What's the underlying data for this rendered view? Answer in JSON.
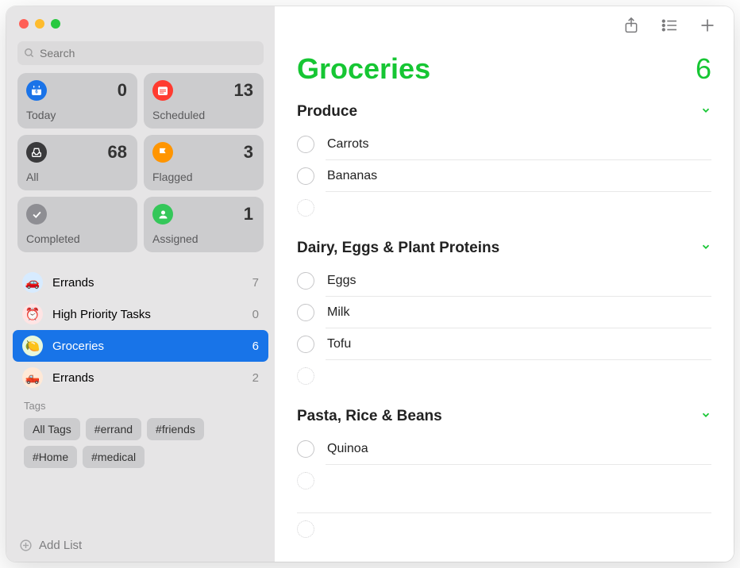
{
  "search": {
    "placeholder": "Search"
  },
  "smart": [
    {
      "label": "Today",
      "count": 0,
      "color": "#1a73e8",
      "icon": "calendar"
    },
    {
      "label": "Scheduled",
      "count": 13,
      "color": "#ff3b30",
      "icon": "calendar-lines"
    },
    {
      "label": "All",
      "count": 68,
      "color": "#3a3a3c",
      "icon": "tray"
    },
    {
      "label": "Flagged",
      "count": 3,
      "color": "#ff9500",
      "icon": "flag"
    },
    {
      "label": "Completed",
      "count": "",
      "color": "#8e8e93",
      "icon": "check"
    },
    {
      "label": "Assigned",
      "count": 1,
      "color": "#34c759",
      "icon": "person"
    }
  ],
  "lists": [
    {
      "name": "Errands",
      "count": 7,
      "emoji": "🚗",
      "selected": false
    },
    {
      "name": "High Priority Tasks",
      "count": 0,
      "emoji": "⏰",
      "selected": false
    },
    {
      "name": "Groceries",
      "count": 6,
      "emoji": "🍋",
      "selected": true
    },
    {
      "name": "Errands",
      "count": 2,
      "emoji": "🛻",
      "selected": false
    }
  ],
  "tags": {
    "title": "Tags",
    "items": [
      "All Tags",
      "#errand",
      "#friends",
      "#Home",
      "#medical"
    ]
  },
  "add_list": "Add List",
  "main": {
    "title": "Groceries",
    "count": 6,
    "accent": "#16c633",
    "sections": [
      {
        "title": "Produce",
        "items": [
          "Carrots",
          "Bananas"
        ]
      },
      {
        "title": "Dairy, Eggs & Plant Proteins",
        "items": [
          "Eggs",
          "Milk",
          "Tofu"
        ]
      },
      {
        "title": "Pasta, Rice & Beans",
        "items": [
          "Quinoa"
        ]
      }
    ]
  }
}
